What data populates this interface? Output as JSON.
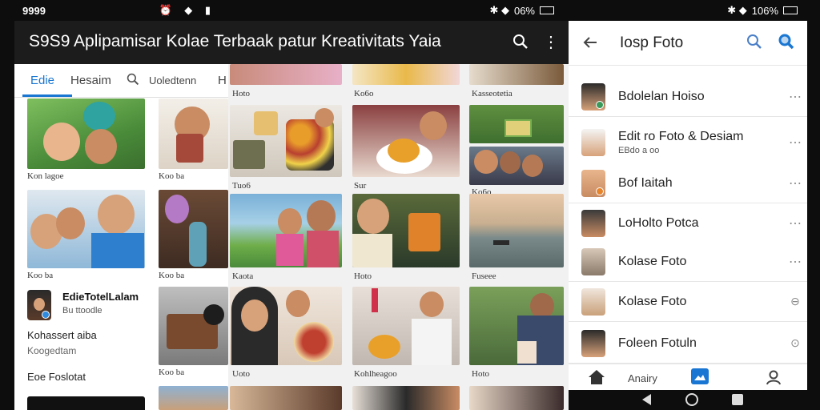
{
  "status_left": {
    "time": "9999"
  },
  "status_mid": {
    "battery": "06%"
  },
  "status_right": {
    "battery": "106%"
  },
  "header": {
    "title": "S9S9 Aplipamisar Kolae Terbaak patur Kreativitats Yaia"
  },
  "tabs": [
    {
      "label": "Edie"
    },
    {
      "label": "Hesaim"
    },
    {
      "label": "Uoledtenn"
    },
    {
      "label": "H"
    }
  ],
  "left_col": {
    "captions": [
      "Kon lagoe",
      "Koo ba",
      "Kohassert aiba",
      "Koogedtam",
      "Eoe Foslotat"
    ],
    "profile": {
      "title": "EdieTotelLalam",
      "sub": "Bu ttoodle"
    }
  },
  "mid_captions": [
    "Tuo6",
    "Sur",
    "Kaota",
    "Hoto",
    "Uoto",
    "Uoto",
    "Kohlheagoo"
  ],
  "grid_captions": [
    "Ko6o",
    "Hoto",
    "Fuseee",
    "Hoto",
    "Hoto"
  ],
  "grid_top_captions": [
    "Hoto",
    "Ko6o",
    "Kasseotetia"
  ],
  "right_panel": {
    "title": "Iosp Foto",
    "items": [
      {
        "label": "Bdolelan Hoiso",
        "action": "more"
      },
      {
        "label": "Edit ro Foto & Desiam",
        "sub": "EBdo a oo",
        "action": "more"
      },
      {
        "label": "Bof Iaitah",
        "action": "more"
      },
      {
        "label": "LoHolto Potca",
        "action": "more"
      },
      {
        "label": "Kolase Foto",
        "action": "more"
      },
      {
        "label": "Kolase Foto",
        "action": "circle"
      },
      {
        "label": "Foleen Fotuln",
        "action": "circle"
      }
    ],
    "bottom_nav": {
      "home": "home-icon",
      "center_label": "Anairy",
      "active": "gallery-icon",
      "profile": "profile-icon"
    }
  },
  "colors": {
    "header_bg": "#1c1c1c",
    "accent": "#1976d2",
    "panel_bg": "#ffffff"
  }
}
